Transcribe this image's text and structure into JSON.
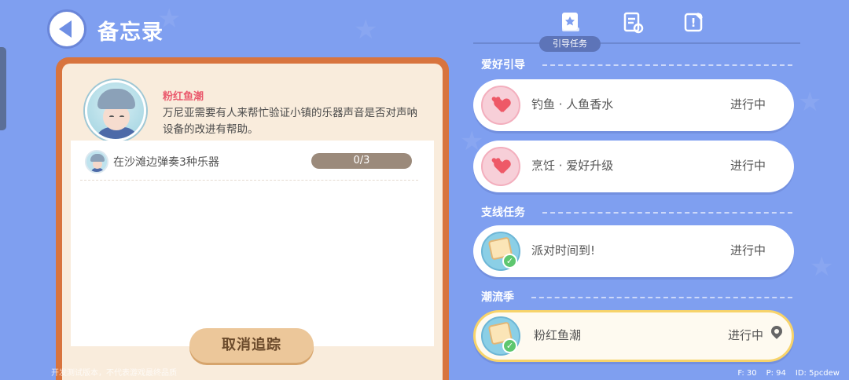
{
  "header": {
    "title": "备忘录"
  },
  "npc": {
    "name": "粉红鱼潮",
    "description": "万尼亚需要有人来帮忙验证小镇的乐器声音是否对声呐设备的改进有帮助。"
  },
  "task": {
    "label": "在沙滩边弹奏3种乐器",
    "progress": "0/3"
  },
  "cancel_button": "取消追踪",
  "tabs": {
    "active_label": "引导任务",
    "icons": [
      "guide-book-icon",
      "clipboard-icon",
      "quest-book-icon"
    ]
  },
  "sections": [
    {
      "title": "爱好引导",
      "items": [
        {
          "name": "钓鱼 · 人鱼香水",
          "status": "进行中",
          "icon": "hearts-icon"
        },
        {
          "name": "烹饪 · 爱好升级",
          "status": "进行中",
          "icon": "hearts-icon"
        }
      ]
    },
    {
      "title": "支线任务",
      "items": [
        {
          "name": "派对时间到!",
          "status": "进行中",
          "icon": "scroll-check-icon"
        }
      ]
    },
    {
      "title": "潮流季",
      "items": [
        {
          "name": "粉红鱼潮",
          "status": "进行中",
          "icon": "scroll-check-icon",
          "tracked": true
        }
      ]
    }
  ],
  "footer": {
    "notice": "开发测试版本，不代表游戏最终品质",
    "fps": "F: 30",
    "ping": "P: 94",
    "id": "ID: 5pcdew"
  }
}
